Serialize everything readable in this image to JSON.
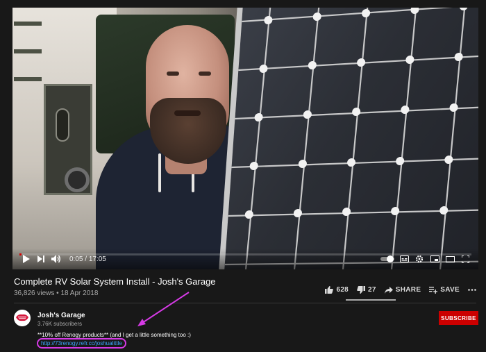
{
  "player": {
    "current_time": "0:05",
    "duration": "17:05",
    "progress_fraction": 0.005
  },
  "video": {
    "title": "Complete RV Solar System Install - Josh's Garage",
    "views": "36,826 views",
    "separator": "•",
    "date": "18 Apr 2018"
  },
  "actions": {
    "likes": "628",
    "dislikes": "27",
    "share_label": "SHARE",
    "save_label": "SAVE",
    "more_icon": "more-horiz-icon"
  },
  "channel": {
    "name": "Josh's Garage",
    "subscribers": "3.76K subscribers",
    "avatar_text": "Josh's Garage",
    "subscribe_label": "SUBSCRIBE"
  },
  "description": {
    "line1": "**10% off Renogy products**  (and I get a little something too :)",
    "link": "http://73renogy.refr.cc/joshualittle"
  },
  "colors": {
    "accent_red": "#cc0000",
    "link_blue": "#3ea6ff",
    "annotation_magenta": "#d63ae6",
    "background": "#181818"
  }
}
